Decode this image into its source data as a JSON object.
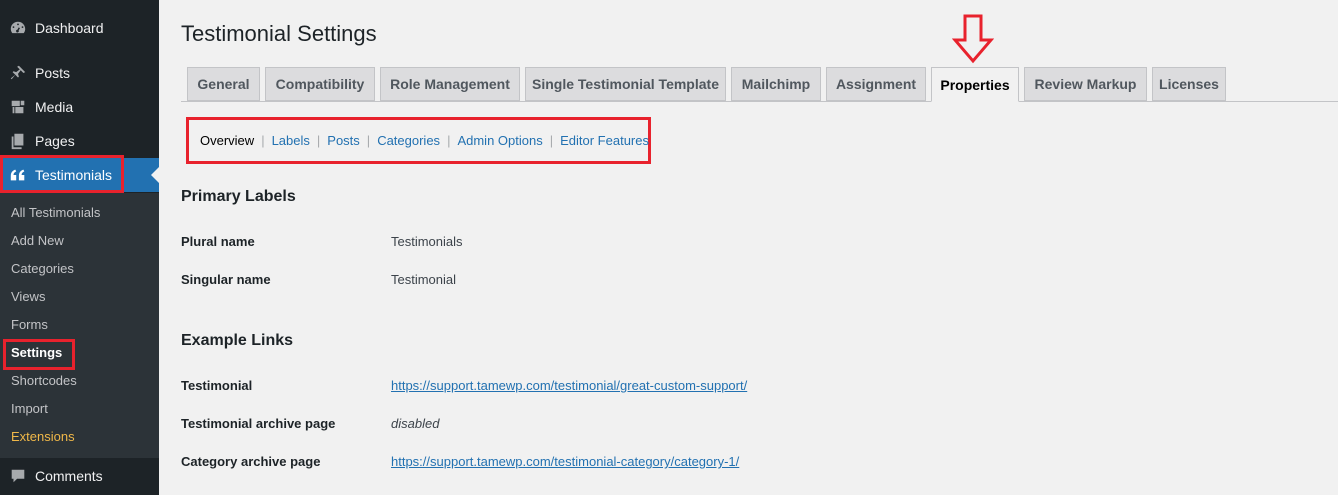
{
  "sidebar": {
    "top_items": [
      {
        "label": "Dashboard",
        "icon": "dashboard-icon"
      },
      {
        "label": "Posts",
        "icon": "pin-icon"
      },
      {
        "label": "Media",
        "icon": "media-icon"
      },
      {
        "label": "Pages",
        "icon": "pages-icon"
      },
      {
        "label": "Testimonials",
        "icon": "quote-icon"
      }
    ],
    "submenu": [
      "All Testimonials",
      "Add New",
      "Categories",
      "Views",
      "Forms",
      "Settings",
      "Shortcodes",
      "Import",
      "Extensions"
    ],
    "bottom_items": [
      {
        "label": "Comments",
        "icon": "comment-icon"
      }
    ]
  },
  "page": {
    "title": "Testimonial Settings"
  },
  "tabs": [
    "General",
    "Compatibility",
    "Role Management",
    "Single Testimonial Template",
    "Mailchimp",
    "Assignment",
    "Properties",
    "Review Markup",
    "Licenses"
  ],
  "active_tab": "Properties",
  "subnav": {
    "items": [
      "Overview",
      "Labels",
      "Posts",
      "Categories",
      "Admin Options",
      "Editor Features"
    ],
    "separator": "|",
    "current": "Overview"
  },
  "primary_labels": {
    "title": "Primary Labels",
    "rows": [
      {
        "label": "Plural name",
        "value": "Testimonials"
      },
      {
        "label": "Singular name",
        "value": "Testimonial"
      }
    ]
  },
  "example_links": {
    "title": "Example Links",
    "rows": [
      {
        "label": "Testimonial",
        "value": "https://support.tamewp.com/testimonial/great-custom-support/"
      },
      {
        "label": "Testimonial archive page",
        "value": "disabled"
      },
      {
        "label": "Category archive page",
        "value": "https://support.tamewp.com/testimonial-category/category-1/"
      }
    ]
  },
  "colors": {
    "sidebar_bg": "#1d2327",
    "submenu_bg": "#2c3338",
    "accent": "#2271b1",
    "highlight": "#e8222d",
    "extensions": "#f0b849"
  }
}
